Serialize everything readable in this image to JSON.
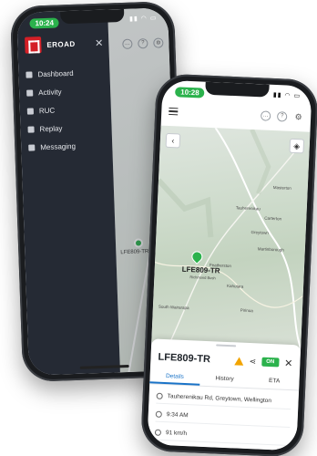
{
  "back_phone": {
    "time": "10:24",
    "brand": "EROAD",
    "menu": [
      {
        "label": "Dashboard",
        "icon": "dashboard-icon"
      },
      {
        "label": "Activity",
        "icon": "activity-icon"
      },
      {
        "label": "RUC",
        "icon": "ruc-icon"
      },
      {
        "label": "Replay",
        "icon": "replay-icon"
      },
      {
        "label": "Messaging",
        "icon": "messaging-icon"
      }
    ],
    "map_vehicle_label": "LFE809-TR"
  },
  "front_phone": {
    "time": "10:28",
    "map": {
      "vehicle_label": "LFE809-TR",
      "vehicle_sub": "Richmond Bush",
      "places": [
        "Tauherenikau",
        "Greytown",
        "Featherston",
        "Martinborough",
        "Carterton",
        "Masterton",
        "Kahutara",
        "Pirinoa",
        "South Wairarapa"
      ]
    },
    "sheet": {
      "vehicle_name": "LFE809-TR",
      "ignition_badge": "ON",
      "tabs": [
        "Details",
        "History",
        "ETA"
      ],
      "active_tab": "Details",
      "location": "Tauherenikau Rd, Greytown, Wellington",
      "time": "9:34 AM",
      "speed": "91 km/h"
    }
  },
  "colors": {
    "accent_green": "#2bb24c",
    "brand_red": "#d41f26",
    "drawer_bg": "#252a34",
    "tab_blue": "#1a73c7",
    "warning": "#f2a400"
  }
}
